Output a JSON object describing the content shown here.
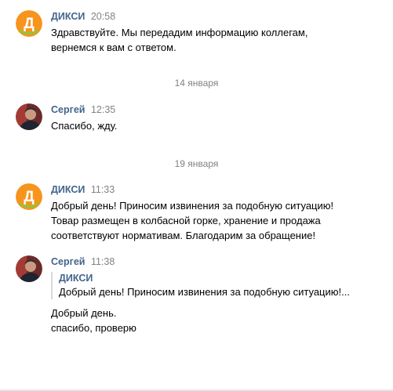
{
  "messages": [
    {
      "author": "ДИКСИ",
      "time": "20:58",
      "avatar_letter": "Д",
      "text": "Здравствуйте. Мы передадим информацию коллегам,\nвернемся к вам с ответом."
    },
    {
      "author": "Сергей",
      "time": "12:35",
      "text": "Спасибо, жду."
    },
    {
      "author": "ДИКСИ",
      "time": "11:33",
      "avatar_letter": "Д",
      "text": "Добрый день! Приносим извинения за подобную ситуацию!\nТовар размещен в колбасной горке, хранение и продажа\nсоответствуют нормативам. Благодарим за обращение!"
    },
    {
      "author": "Сергей",
      "time": "11:38",
      "quote": {
        "author": "ДИКСИ",
        "text": "Добрый день! Приносим извинения за подобную ситуацию!..."
      },
      "text": "Добрый день.\nспасибо, проверю"
    }
  ],
  "date_separators": [
    "14 января",
    "19 января"
  ],
  "colors": {
    "brand_orange": "#f7941d",
    "brand_green": "#8dc63f",
    "author_link": "#42648b",
    "muted": "#828282"
  },
  "icons": {
    "dixy_avatar": "dixy-logo-avatar",
    "user_avatar": "user-photo-avatar"
  }
}
